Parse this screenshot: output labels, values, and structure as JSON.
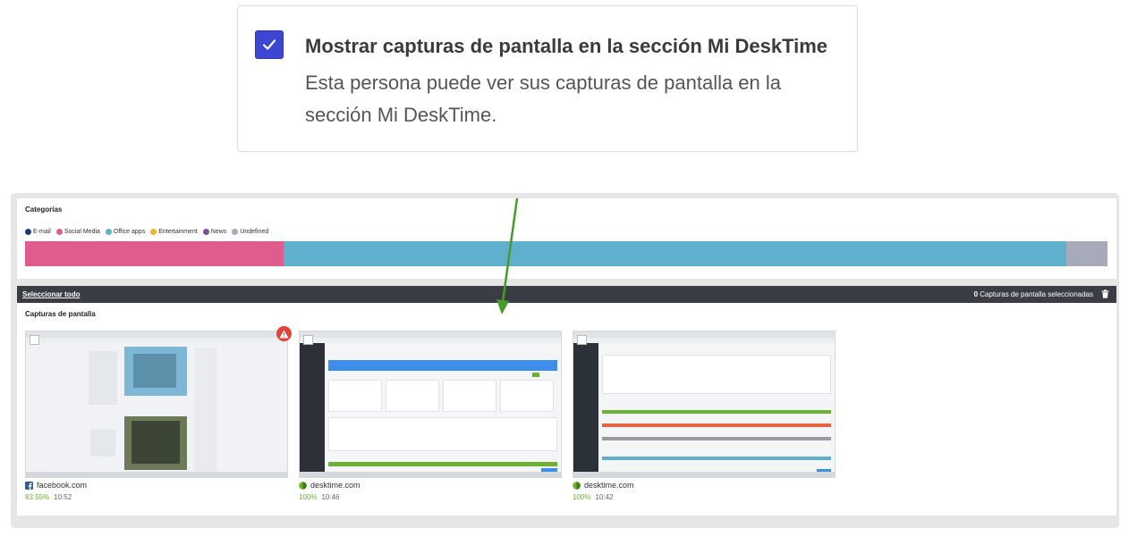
{
  "callout": {
    "title": "Mostrar capturas de pantalla en la sección Mi DeskTime",
    "description": "Esta persona puede ver sus capturas de pantalla en la sección Mi DeskTime."
  },
  "categories": {
    "title": "Categorías",
    "legend": [
      {
        "label": "E-mail",
        "color": "#1f3b73"
      },
      {
        "label": "Social Media",
        "color": "#df5c8c"
      },
      {
        "label": "Office apps",
        "color": "#5fb0cd"
      },
      {
        "label": "Entertainment",
        "color": "#f0b32e"
      },
      {
        "label": "News",
        "color": "#7b4f9e"
      },
      {
        "label": "Undefined",
        "color": "#a6aab9"
      }
    ],
    "bar": [
      {
        "category": "Social Media",
        "fraction": 0.239,
        "color": "#df5c8c"
      },
      {
        "category": "Office apps",
        "fraction": 0.723,
        "color": "#5fb0cd"
      },
      {
        "category": "Undefined",
        "fraction": 0.038,
        "color": "#a6aab9"
      }
    ]
  },
  "toolbar": {
    "select_all": "Seleccionar todo",
    "selected_count": "0",
    "selected_label": "Capturas de pantalla seleccionadas"
  },
  "screenshots": {
    "title": "Capturas de pantalla",
    "items": [
      {
        "site": "facebook.com",
        "icon": "facebook-icon",
        "percent": "83.55%",
        "time": "10:52"
      },
      {
        "site": "desktime.com",
        "icon": "desktime-icon",
        "percent": "100%",
        "time": "10:46"
      },
      {
        "site": "desktime.com",
        "icon": "desktime-icon",
        "percent": "100%",
        "time": "10:42"
      }
    ]
  }
}
